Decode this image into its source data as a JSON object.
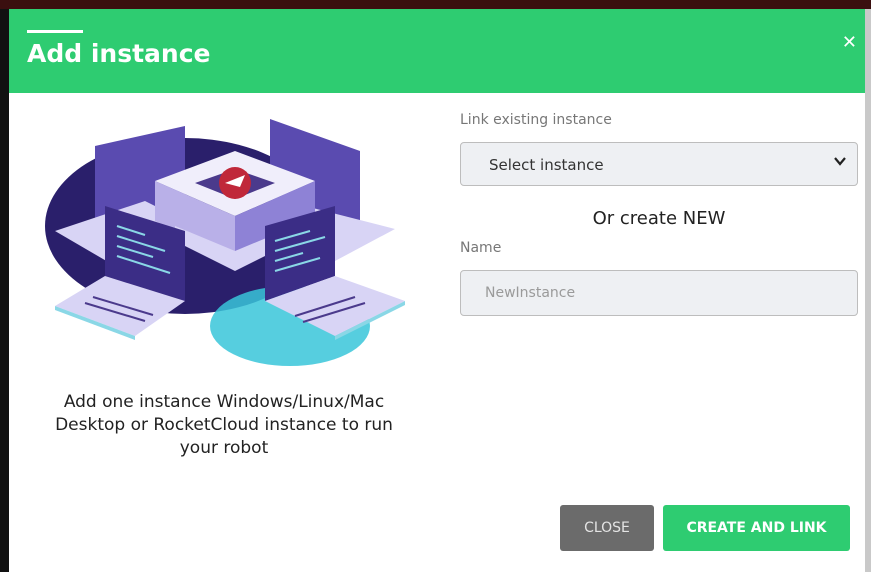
{
  "dialog": {
    "title": "Add instance",
    "close_icon": "close-icon"
  },
  "illustration": {
    "icon": "server-laptops-illustration"
  },
  "description": {
    "line1": "Add one instance Windows/Linux/Mac",
    "line2": "Desktop or RocketCloud instance to run",
    "line3": "your robot"
  },
  "link_existing": {
    "label": "Link existing instance",
    "selected": "Select instance",
    "chevron_icon": "chevron-down-icon"
  },
  "create_new": {
    "heading": "Or create NEW",
    "name_label": "Name",
    "name_placeholder": "NewInstance",
    "name_value": ""
  },
  "buttons": {
    "close": "CLOSE",
    "create": "CREATE AND LINK"
  },
  "colors": {
    "brand_green": "#2ecc71",
    "close_button": "#6b6b6b",
    "illustration_purple": "#4b3a8c",
    "illustration_cyan": "#38c6d9",
    "illustration_red": "#c0283a"
  }
}
